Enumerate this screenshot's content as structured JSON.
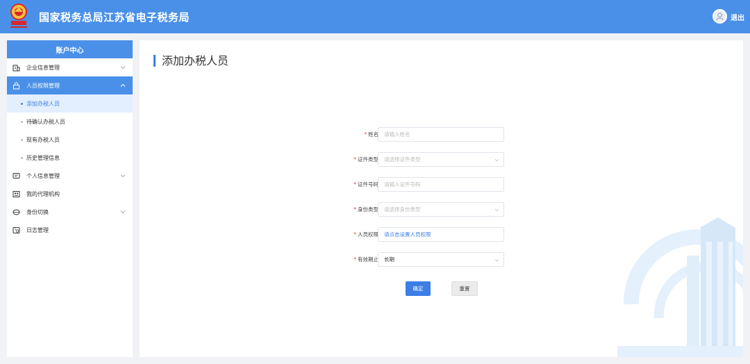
{
  "header": {
    "site_title": "国家税务总局江苏省电子税务局",
    "user_name": "退出"
  },
  "sidebar": {
    "title": "账户中心",
    "items": [
      {
        "label": "企业信息管理",
        "icon": "building-icon",
        "expandable": true,
        "active": false
      },
      {
        "label": "人员权限管理",
        "icon": "lock-icon",
        "expandable": true,
        "active": true,
        "children": [
          {
            "label": "添加办税人员",
            "active": true
          },
          {
            "label": "待确认办税人员",
            "active": false
          },
          {
            "label": "现有办税人员",
            "active": false
          },
          {
            "label": "历史管理信息",
            "active": false
          }
        ]
      },
      {
        "label": "个人信息管理",
        "icon": "chat-icon",
        "expandable": true,
        "active": false
      },
      {
        "label": "我的代理机构",
        "icon": "agency-icon",
        "expandable": false,
        "active": false
      },
      {
        "label": "身份切换",
        "icon": "switch-icon",
        "expandable": true,
        "active": false
      },
      {
        "label": "日志管理",
        "icon": "log-icon",
        "expandable": false,
        "active": false
      }
    ]
  },
  "main": {
    "page_title": "添加办税人员",
    "form": {
      "name": {
        "label": "姓名",
        "placeholder": "请输入姓名"
      },
      "id_type": {
        "label": "证件类型",
        "placeholder": "请选择证件类型"
      },
      "id_number": {
        "label": "证件号码",
        "placeholder": "请输入证件号码"
      },
      "identity_type": {
        "label": "身份类型",
        "placeholder": "请选择身份类型"
      },
      "permissions": {
        "label": "人员权限",
        "value": "请点击设置人员权限"
      },
      "validity": {
        "label": "有效期止",
        "value": "长期"
      }
    },
    "buttons": {
      "confirm": "确定",
      "reset": "重置"
    }
  },
  "colors": {
    "primary": "#4a90e8",
    "link": "#3c7ee6",
    "required": "#e23c3c"
  }
}
